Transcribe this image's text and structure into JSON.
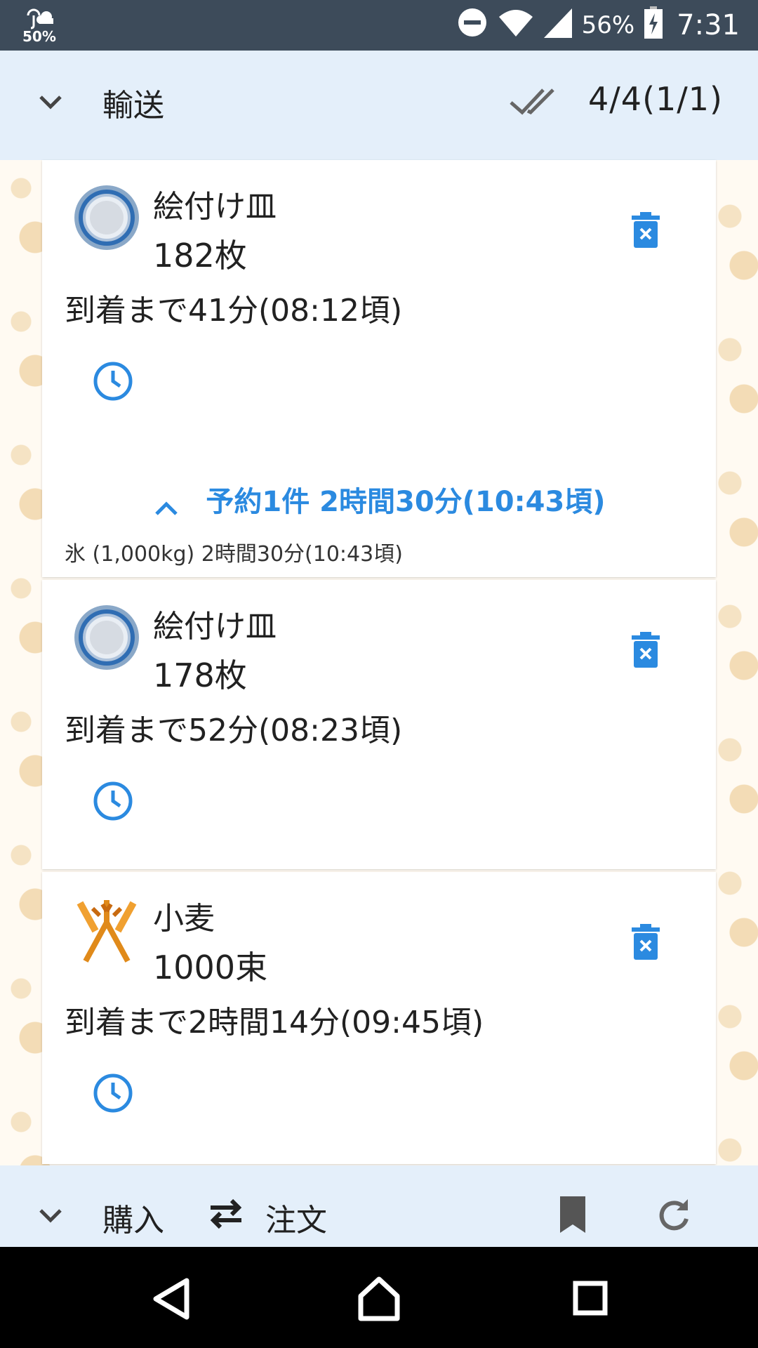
{
  "status_bar": {
    "weather_percent": "50%",
    "battery_percent": "56%",
    "time": "7:31"
  },
  "header": {
    "title": "輸送",
    "count": "4/4(1/1)"
  },
  "shipments": [
    {
      "item_name": "絵付け皿",
      "quantity": "182枚",
      "arrival": "到着まで41分(08:12頃)",
      "icon": "plate-icon"
    },
    {
      "item_name": "絵付け皿",
      "quantity": "178枚",
      "arrival": "到着まで52分(08:23頃)",
      "icon": "plate-icon"
    },
    {
      "item_name": "小麦",
      "quantity": "1000束",
      "arrival": "到着まで2時間14分(09:45頃)",
      "icon": "wheat-icon"
    }
  ],
  "reservation": {
    "summary": "予約1件 2時間30分(10:43頃)",
    "detail": "氷 (1,000kg) 2時間30分(10:43頃)"
  },
  "bottom_bar": {
    "buy_label": "購入",
    "order_label": "注文"
  },
  "colors": {
    "accent": "#2b8ae0",
    "header_bg": "#e4effa",
    "status_bar_bg": "#3d4b5a"
  }
}
